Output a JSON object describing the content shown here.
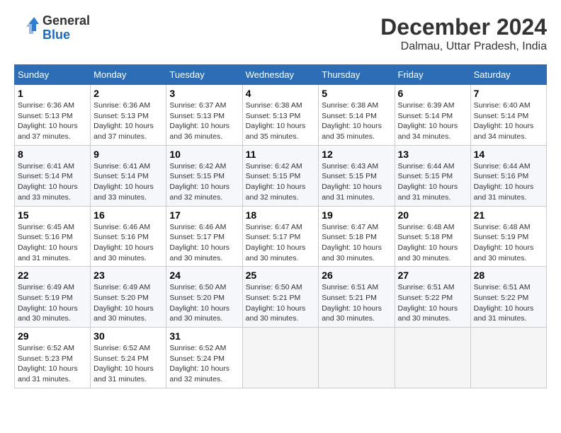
{
  "header": {
    "logo_line1": "General",
    "logo_line2": "Blue",
    "title": "December 2024",
    "subtitle": "Dalmau, Uttar Pradesh, India"
  },
  "calendar": {
    "days_of_week": [
      "Sunday",
      "Monday",
      "Tuesday",
      "Wednesday",
      "Thursday",
      "Friday",
      "Saturday"
    ],
    "weeks": [
      [
        {
          "day": "1",
          "sunrise": "6:36 AM",
          "sunset": "5:13 PM",
          "daylight": "10 hours and 37 minutes."
        },
        {
          "day": "2",
          "sunrise": "6:36 AM",
          "sunset": "5:13 PM",
          "daylight": "10 hours and 37 minutes."
        },
        {
          "day": "3",
          "sunrise": "6:37 AM",
          "sunset": "5:13 PM",
          "daylight": "10 hours and 36 minutes."
        },
        {
          "day": "4",
          "sunrise": "6:38 AM",
          "sunset": "5:13 PM",
          "daylight": "10 hours and 35 minutes."
        },
        {
          "day": "5",
          "sunrise": "6:38 AM",
          "sunset": "5:14 PM",
          "daylight": "10 hours and 35 minutes."
        },
        {
          "day": "6",
          "sunrise": "6:39 AM",
          "sunset": "5:14 PM",
          "daylight": "10 hours and 34 minutes."
        },
        {
          "day": "7",
          "sunrise": "6:40 AM",
          "sunset": "5:14 PM",
          "daylight": "10 hours and 34 minutes."
        }
      ],
      [
        {
          "day": "8",
          "sunrise": "6:41 AM",
          "sunset": "5:14 PM",
          "daylight": "10 hours and 33 minutes."
        },
        {
          "day": "9",
          "sunrise": "6:41 AM",
          "sunset": "5:14 PM",
          "daylight": "10 hours and 33 minutes."
        },
        {
          "day": "10",
          "sunrise": "6:42 AM",
          "sunset": "5:15 PM",
          "daylight": "10 hours and 32 minutes."
        },
        {
          "day": "11",
          "sunrise": "6:42 AM",
          "sunset": "5:15 PM",
          "daylight": "10 hours and 32 minutes."
        },
        {
          "day": "12",
          "sunrise": "6:43 AM",
          "sunset": "5:15 PM",
          "daylight": "10 hours and 31 minutes."
        },
        {
          "day": "13",
          "sunrise": "6:44 AM",
          "sunset": "5:15 PM",
          "daylight": "10 hours and 31 minutes."
        },
        {
          "day": "14",
          "sunrise": "6:44 AM",
          "sunset": "5:16 PM",
          "daylight": "10 hours and 31 minutes."
        }
      ],
      [
        {
          "day": "15",
          "sunrise": "6:45 AM",
          "sunset": "5:16 PM",
          "daylight": "10 hours and 31 minutes."
        },
        {
          "day": "16",
          "sunrise": "6:46 AM",
          "sunset": "5:16 PM",
          "daylight": "10 hours and 30 minutes."
        },
        {
          "day": "17",
          "sunrise": "6:46 AM",
          "sunset": "5:17 PM",
          "daylight": "10 hours and 30 minutes."
        },
        {
          "day": "18",
          "sunrise": "6:47 AM",
          "sunset": "5:17 PM",
          "daylight": "10 hours and 30 minutes."
        },
        {
          "day": "19",
          "sunrise": "6:47 AM",
          "sunset": "5:18 PM",
          "daylight": "10 hours and 30 minutes."
        },
        {
          "day": "20",
          "sunrise": "6:48 AM",
          "sunset": "5:18 PM",
          "daylight": "10 hours and 30 minutes."
        },
        {
          "day": "21",
          "sunrise": "6:48 AM",
          "sunset": "5:19 PM",
          "daylight": "10 hours and 30 minutes."
        }
      ],
      [
        {
          "day": "22",
          "sunrise": "6:49 AM",
          "sunset": "5:19 PM",
          "daylight": "10 hours and 30 minutes."
        },
        {
          "day": "23",
          "sunrise": "6:49 AM",
          "sunset": "5:20 PM",
          "daylight": "10 hours and 30 minutes."
        },
        {
          "day": "24",
          "sunrise": "6:50 AM",
          "sunset": "5:20 PM",
          "daylight": "10 hours and 30 minutes."
        },
        {
          "day": "25",
          "sunrise": "6:50 AM",
          "sunset": "5:21 PM",
          "daylight": "10 hours and 30 minutes."
        },
        {
          "day": "26",
          "sunrise": "6:51 AM",
          "sunset": "5:21 PM",
          "daylight": "10 hours and 30 minutes."
        },
        {
          "day": "27",
          "sunrise": "6:51 AM",
          "sunset": "5:22 PM",
          "daylight": "10 hours and 30 minutes."
        },
        {
          "day": "28",
          "sunrise": "6:51 AM",
          "sunset": "5:22 PM",
          "daylight": "10 hours and 31 minutes."
        }
      ],
      [
        {
          "day": "29",
          "sunrise": "6:52 AM",
          "sunset": "5:23 PM",
          "daylight": "10 hours and 31 minutes."
        },
        {
          "day": "30",
          "sunrise": "6:52 AM",
          "sunset": "5:24 PM",
          "daylight": "10 hours and 31 minutes."
        },
        {
          "day": "31",
          "sunrise": "6:52 AM",
          "sunset": "5:24 PM",
          "daylight": "10 hours and 32 minutes."
        },
        null,
        null,
        null,
        null
      ]
    ]
  }
}
